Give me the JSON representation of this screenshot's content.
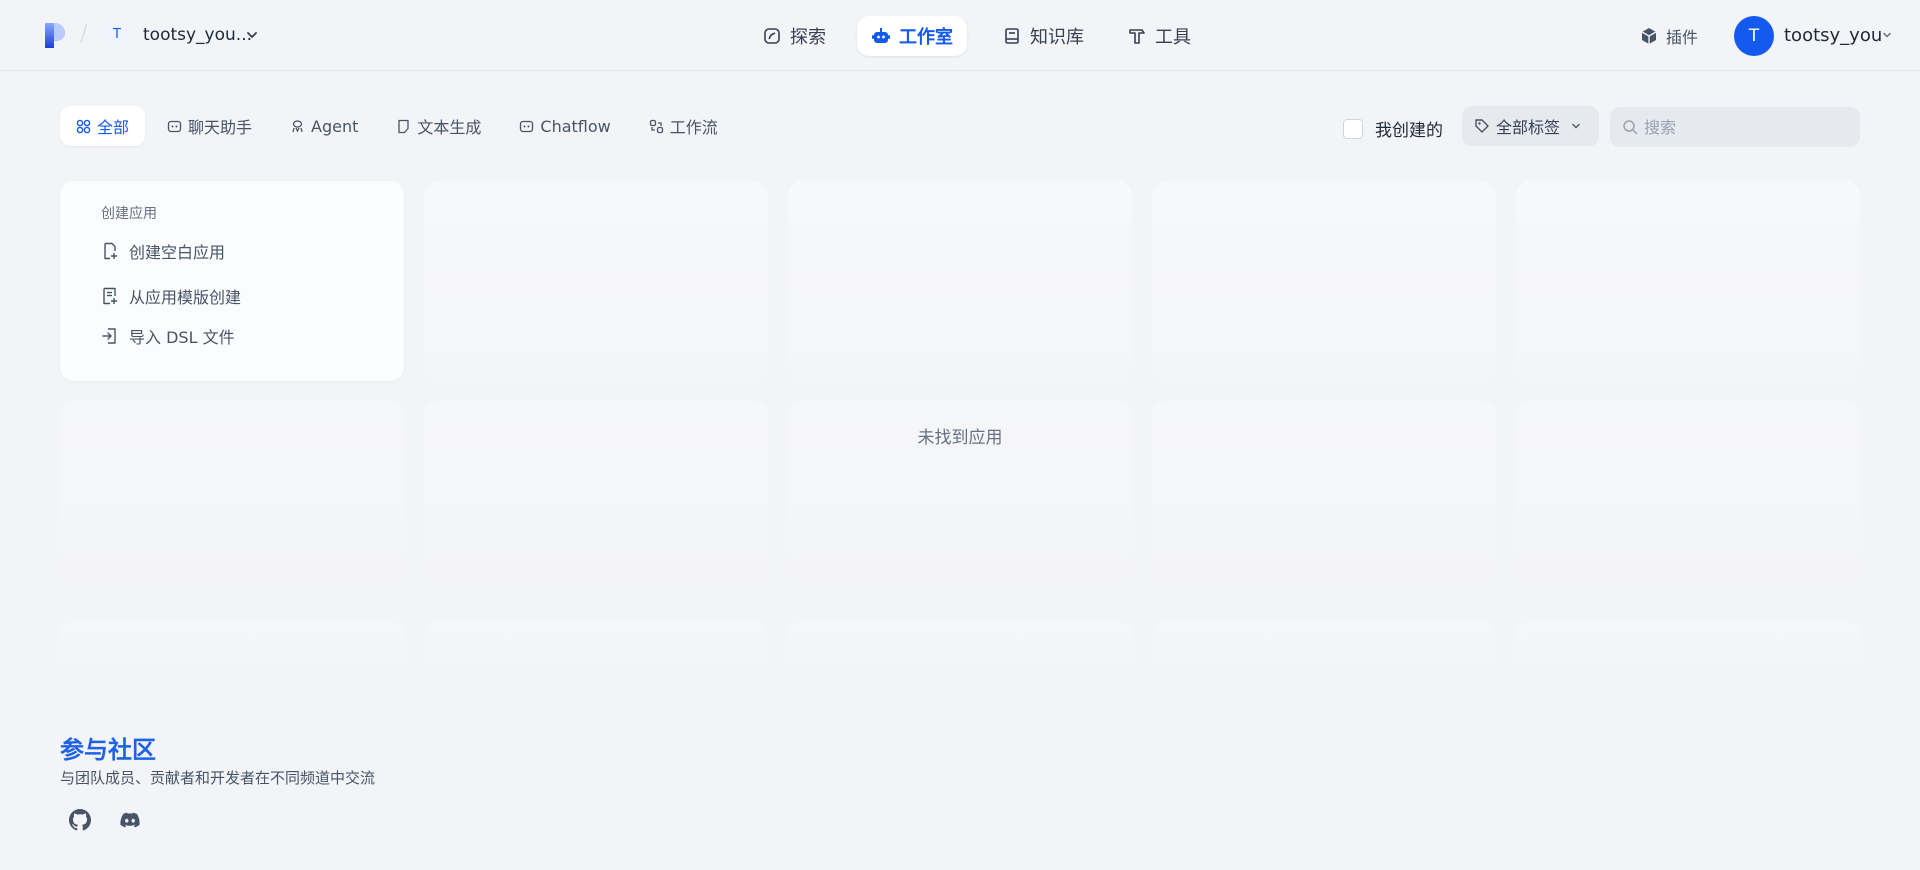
{
  "header": {
    "workspace_initial": "T",
    "workspace_name": "tootsy_you...",
    "separator": "/",
    "nav": [
      {
        "label": "探索",
        "icon": "compass-icon"
      },
      {
        "label": "工作室",
        "icon": "robot-icon"
      },
      {
        "label": "知识库",
        "icon": "book-icon"
      },
      {
        "label": "工具",
        "icon": "hammer-icon"
      }
    ],
    "plugin_label": "插件",
    "user_initial": "T",
    "user_name": "tootsy_you"
  },
  "filters": {
    "tabs": [
      {
        "label": "全部",
        "icon": "grid-icon"
      },
      {
        "label": "聊天助手",
        "icon": "chat-bot-icon"
      },
      {
        "label": "Agent",
        "icon": "agent-icon"
      },
      {
        "label": "文本生成",
        "icon": "document-icon"
      },
      {
        "label": "Chatflow",
        "icon": "chatflow-icon"
      },
      {
        "label": "工作流",
        "icon": "workflow-icon"
      }
    ],
    "created_by_me": "我创建的",
    "tags_label": "全部标签",
    "search_placeholder": "搜索"
  },
  "create_card": {
    "title": "创建应用",
    "items": [
      {
        "label": "创建空白应用",
        "icon": "file-plus-icon"
      },
      {
        "label": "从应用模版创建",
        "icon": "template-icon"
      },
      {
        "label": "导入 DSL 文件",
        "icon": "import-icon"
      }
    ]
  },
  "empty_text": "未找到应用",
  "community": {
    "title": "参与社区",
    "subtitle": "与团队成员、贡献者和开发者在不同频道中交流",
    "links": [
      "github-icon",
      "discord-icon"
    ]
  },
  "colors": {
    "accent": "#155aef",
    "background": "#f2f4f7",
    "community_title": "#1f62e8"
  }
}
